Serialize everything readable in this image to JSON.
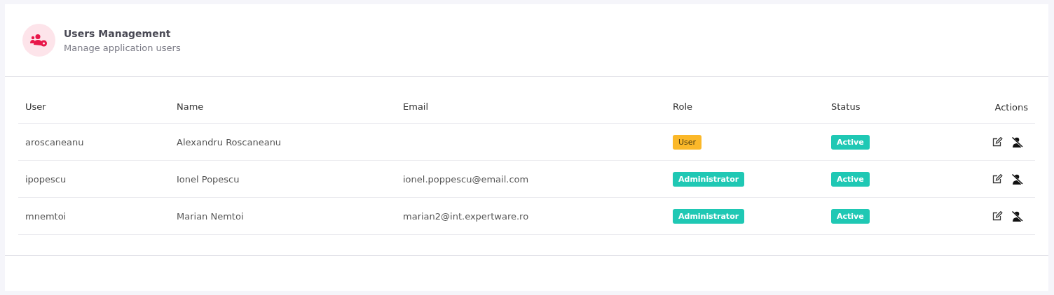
{
  "header": {
    "title": "Users Management",
    "subtitle": "Manage application users"
  },
  "table": {
    "columns": [
      "User",
      "Name",
      "Email",
      "Role",
      "Status",
      "Actions"
    ],
    "rows": [
      {
        "user": "aroscaneanu",
        "name": "Alexandru Roscaneanu",
        "role": {
          "label": "User",
          "kind": "user"
        },
        "status": "Active"
      },
      {
        "user": "ipopescu",
        "name": "Ionel Popescu",
        "email": "ionel.poppescu@email.com",
        "role": {
          "label": "Administrator",
          "kind": "admin"
        },
        "status": "Active"
      },
      {
        "user": "mnemtoi",
        "name": "Marian Nemtoi",
        "email": "marian2@int.expertware.ro",
        "role": {
          "label": "Administrator",
          "kind": "admin"
        },
        "status": "Active"
      }
    ]
  }
}
